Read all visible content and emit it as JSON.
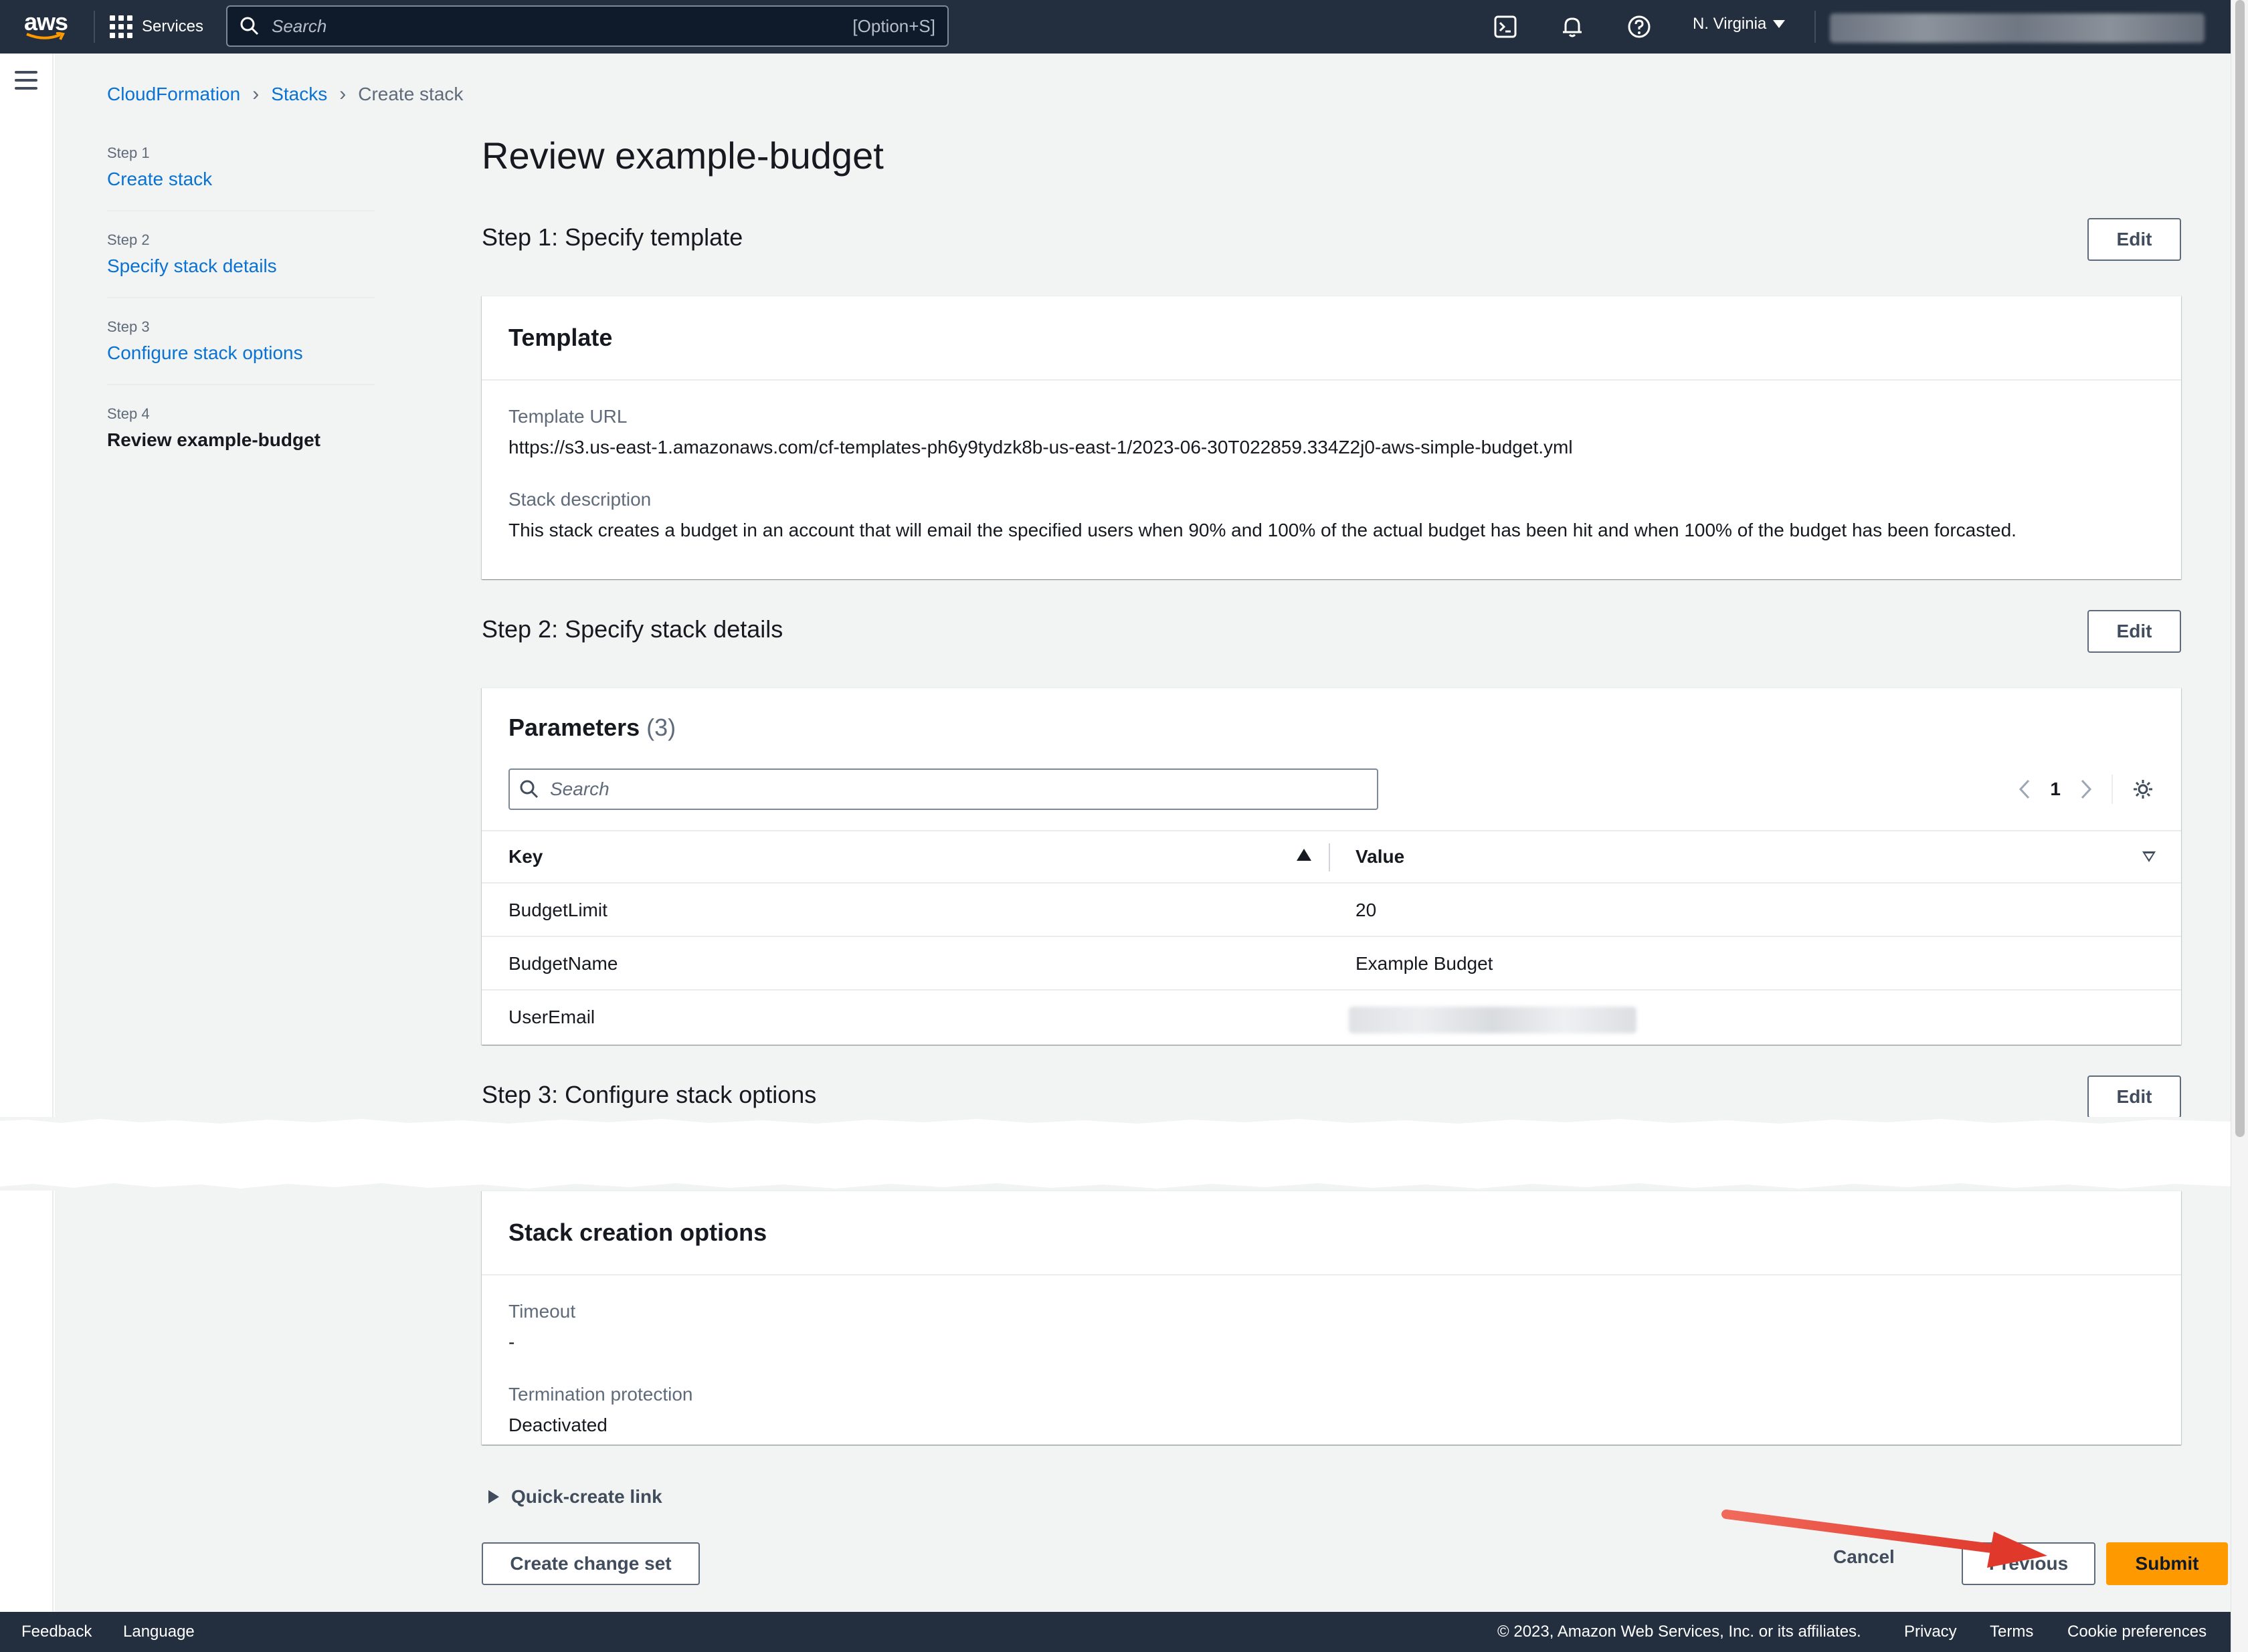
{
  "topnav": {
    "logo": "aws",
    "services_label": "Services",
    "search_placeholder": "Search",
    "search_shortcut": "[Option+S]",
    "region": "N. Virginia",
    "icons": [
      "cloudshell-icon",
      "bell-icon",
      "help-icon"
    ]
  },
  "breadcrumb": {
    "items": [
      "CloudFormation",
      "Stacks"
    ],
    "current": "Create stack"
  },
  "wizard": {
    "steps": [
      {
        "num": "Step 1",
        "label": "Create stack"
      },
      {
        "num": "Step 2",
        "label": "Specify stack details"
      },
      {
        "num": "Step 3",
        "label": "Configure stack options"
      },
      {
        "num": "Step 4",
        "label": "Review example-budget"
      }
    ]
  },
  "page": {
    "title": "Review example-budget"
  },
  "step1": {
    "heading": "Step 1: Specify template",
    "edit_label": "Edit",
    "panel_title": "Template",
    "template_url_label": "Template URL",
    "template_url": "https://s3.us-east-1.amazonaws.com/cf-templates-ph6y9tydzk8b-us-east-1/2023-06-30T022859.334Z2j0-aws-simple-budget.yml",
    "description_label": "Stack description",
    "description": "This stack creates a budget in an account that will email the specified users when 90% and 100% of the actual budget has been hit and when 100% of the budget has been forcasted."
  },
  "step2": {
    "heading": "Step 2: Specify stack details",
    "edit_label": "Edit",
    "panel_title": "Parameters",
    "count": "(3)",
    "search_placeholder": "Search",
    "page_number": "1",
    "columns": {
      "key": "Key",
      "value": "Value"
    },
    "rows": [
      {
        "key": "BudgetLimit",
        "value": "20"
      },
      {
        "key": "BudgetName",
        "value": "Example Budget"
      },
      {
        "key": "UserEmail",
        "value": ""
      }
    ]
  },
  "step3": {
    "heading": "Step 3: Configure stack options",
    "edit_label": "Edit",
    "panel_title": "Stack creation options",
    "timeout_label": "Timeout",
    "timeout_value": "-",
    "termination_label": "Termination protection",
    "termination_value": "Deactivated"
  },
  "actions": {
    "quick_create": "Quick-create link",
    "create_change_set": "Create change set",
    "cancel": "Cancel",
    "previous": "Previous",
    "submit": "Submit"
  },
  "footer": {
    "feedback": "Feedback",
    "language": "Language",
    "copyright": "© 2023, Amazon Web Services, Inc. or its affiliates.",
    "privacy": "Privacy",
    "terms": "Terms",
    "cookie": "Cookie preferences"
  },
  "colors": {
    "nav_bg": "#232f3e",
    "link": "#0972d3",
    "submit": "#ff9900",
    "annotation_arrow": "#e8453c"
  }
}
